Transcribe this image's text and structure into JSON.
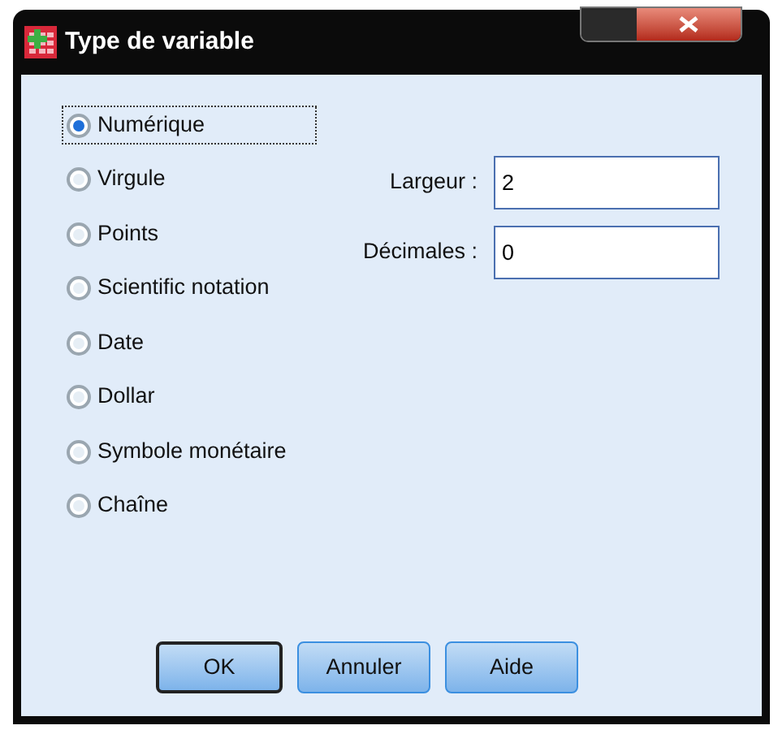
{
  "window": {
    "title": "Type de variable"
  },
  "options": [
    {
      "label": "Numérique",
      "selected": true
    },
    {
      "label": "Virgule",
      "selected": false
    },
    {
      "label": "Points",
      "selected": false
    },
    {
      "label": "Scientific notation",
      "selected": false
    },
    {
      "label": "Date",
      "selected": false
    },
    {
      "label": "Dollar",
      "selected": false
    },
    {
      "label": "Symbole monétaire",
      "selected": false
    },
    {
      "label": "Chaîne",
      "selected": false
    }
  ],
  "fields": [
    {
      "label": "Largeur :",
      "value": "2"
    },
    {
      "label": "Décimales :",
      "value": "0"
    }
  ],
  "buttons": [
    {
      "label": "OK",
      "default": true
    },
    {
      "label": "Annuler",
      "default": false
    },
    {
      "label": "Aide",
      "default": false
    }
  ]
}
